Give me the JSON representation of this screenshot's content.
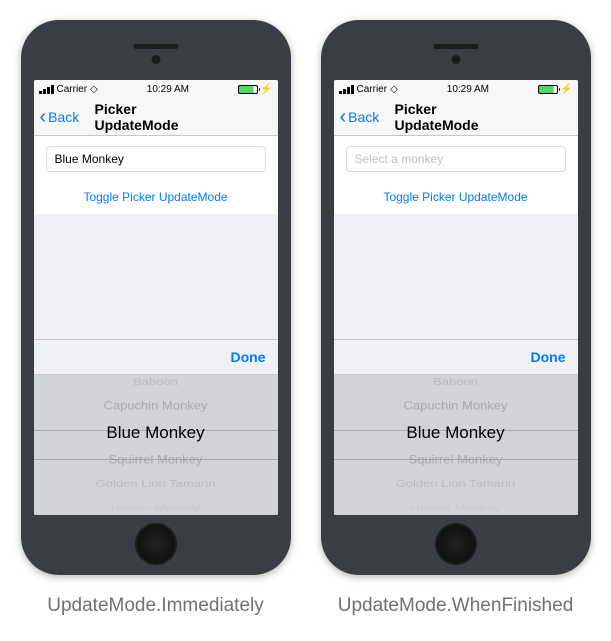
{
  "status": {
    "carrier": "Carrier",
    "time": "10:29 AM",
    "charge_glyph": "⚡"
  },
  "nav": {
    "back_label": "Back",
    "title": "Picker UpdateMode"
  },
  "content": {
    "input_value": "Blue Monkey",
    "input_placeholder": "Select a monkey",
    "toggle_label": "Toggle Picker UpdateMode"
  },
  "picker": {
    "done_label": "Done",
    "items": [
      "Baboon",
      "Capuchin Monkey",
      "Blue Monkey",
      "Squirrel Monkey",
      "Golden Lion Tamarin",
      "Howler Monkey"
    ]
  },
  "captions": {
    "left": "UpdateMode.Immediately",
    "right": "UpdateMode.WhenFinished"
  }
}
